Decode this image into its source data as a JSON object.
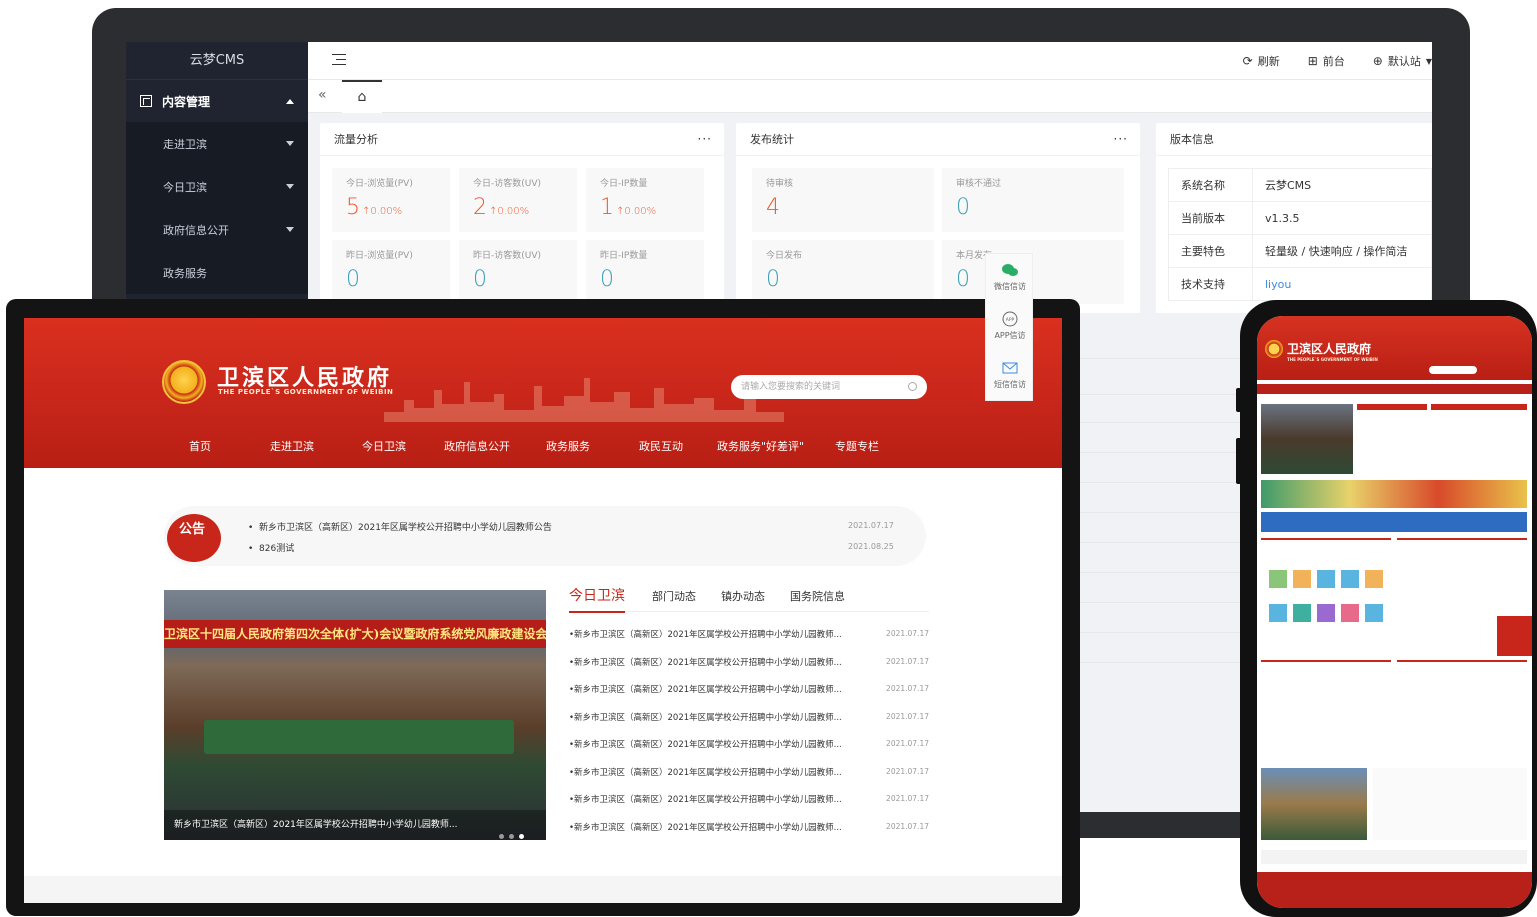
{
  "admin": {
    "logo": "云梦CMS",
    "menu_head": "内容管理",
    "menu_items": [
      "走进卫滨",
      "今日卫滨",
      "政府信息公开",
      "政务服务"
    ],
    "actions": {
      "refresh": "刷新",
      "frontend": "前台",
      "site": "默认站"
    },
    "traffic": {
      "title": "流量分析",
      "more": "···",
      "stats": [
        {
          "label": "今日-浏览量(PV)",
          "value": "5",
          "pct": "↑0.00%"
        },
        {
          "label": "今日-访客数(UV)",
          "value": "2",
          "pct": "↑0.00%"
        },
        {
          "label": "今日-IP数量",
          "value": "1",
          "pct": "↑0.00%"
        },
        {
          "label": "昨日-浏览量(PV)",
          "value": "0"
        },
        {
          "label": "昨日-访客数(UV)",
          "value": "0"
        },
        {
          "label": "昨日-IP数量",
          "value": "0"
        }
      ]
    },
    "publish": {
      "title": "发布统计",
      "more": "···",
      "stats": [
        {
          "label": "待审核",
          "value": "4"
        },
        {
          "label": "审核不通过",
          "value": "0"
        },
        {
          "label": "今日发布",
          "value": "0"
        },
        {
          "label": "本月发布",
          "value": "0"
        }
      ]
    },
    "version": {
      "title": "版本信息",
      "rows": [
        {
          "k": "系统名称",
          "v": "云梦CMS"
        },
        {
          "k": "当前版本",
          "v": "v1.3.5"
        },
        {
          "k": "主要特色",
          "v": "轻量级 / 快速响应 / 操作简洁"
        },
        {
          "k": "技术支持",
          "v": "liyou"
        }
      ]
    }
  },
  "site": {
    "title": "卫滨区人民政府",
    "subtitle": "THE PEOPLE`S GOVERNMENT OF WEIBIN",
    "search_placeholder": "请输入您要搜索的关键词",
    "nav": [
      "首页",
      "走进卫滨",
      "今日卫滨",
      "政府信息公开",
      "政务服务",
      "政民互动",
      "政务服务\"好差评\"",
      "专题专栏"
    ],
    "notice_badge": "公告",
    "notices": [
      {
        "text": "新乡市卫滨区（高新区）2021年区属学校公开招聘中小学幼儿园教师公告",
        "date": "2021.07.17"
      },
      {
        "text": "826测试",
        "date": "2021.08.25"
      }
    ],
    "photo_banner": "卫滨区十四届人民政府第四次全体(扩大)会议暨政府系统党风廉政建设会议",
    "photo_caption": "新乡市卫滨区（高新区）2021年区属学校公开招聘中小学幼儿园教师...",
    "tabs": [
      "今日卫滨",
      "部门动态",
      "镇办动态",
      "国务院信息"
    ],
    "news": [
      {
        "text": "•新乡市卫滨区（高新区）2021年区属学校公开招聘中小学幼儿园教师...",
        "date": "2021.07.17"
      },
      {
        "text": "•新乡市卫滨区（高新区）2021年区属学校公开招聘中小学幼儿园教师...",
        "date": "2021.07.17"
      },
      {
        "text": "•新乡市卫滨区（高新区）2021年区属学校公开招聘中小学幼儿园教师...",
        "date": "2021.07.17"
      },
      {
        "text": "•新乡市卫滨区（高新区）2021年区属学校公开招聘中小学幼儿园教师...",
        "date": "2021.07.17"
      },
      {
        "text": "•新乡市卫滨区（高新区）2021年区属学校公开招聘中小学幼儿园教师...",
        "date": "2021.07.17"
      },
      {
        "text": "•新乡市卫滨区（高新区）2021年区属学校公开招聘中小学幼儿园教师...",
        "date": "2021.07.17"
      },
      {
        "text": "•新乡市卫滨区（高新区）2021年区属学校公开招聘中小学幼儿园教师...",
        "date": "2021.07.17"
      },
      {
        "text": "•新乡市卫滨区（高新区）2021年区属学校公开招聘中小学幼儿园教师...",
        "date": "2021.07.17"
      }
    ],
    "side_links": [
      "微信信访",
      "APP信访",
      "短信信访"
    ]
  },
  "phone": {
    "title": "卫滨区人民政府",
    "subtitle": "THE PEOPLE`S GOVERNMENT OF WEIBIN"
  },
  "colors": {
    "brand_red": "#c8261a",
    "admin_sidebar": "#1f2430",
    "stat_red": "#f0582c",
    "stat_teal": "#3fa0b8"
  }
}
